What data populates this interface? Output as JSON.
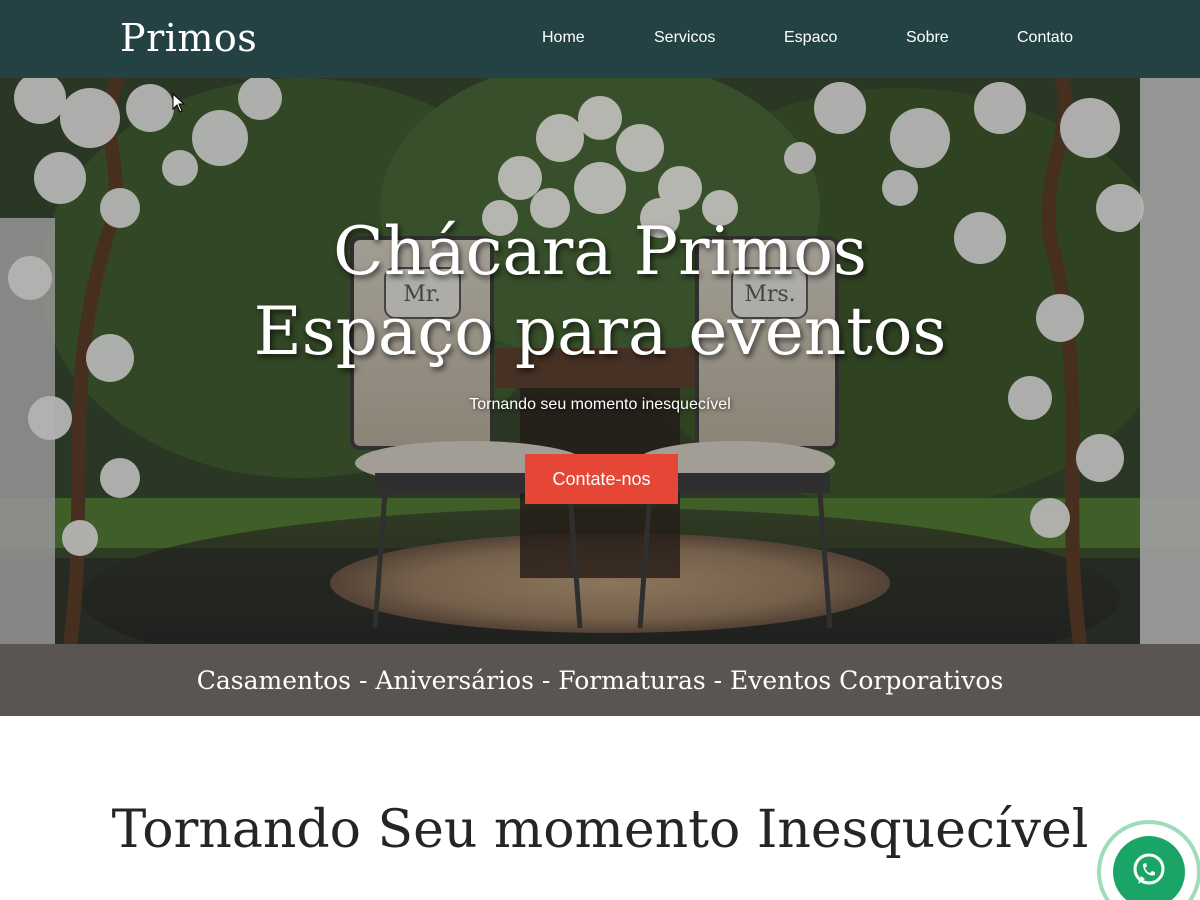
{
  "header": {
    "logo": "Primos",
    "nav": {
      "home": "Home",
      "servicos": "Servicos",
      "espaco": "Espaco",
      "sobre": "Sobre",
      "contato": "Contato"
    }
  },
  "hero": {
    "title_line1": "Chácara Primos",
    "title_line2": "Espaço para eventos",
    "subtitle": "Tornando seu momento inesquecível",
    "cta": "Contate-nos",
    "chair_signs": [
      "Mr.",
      "Mrs."
    ]
  },
  "strip": {
    "text": "Casamentos - Aniversários - Formaturas - Eventos Corporativos"
  },
  "section": {
    "heading": "Tornando Seu momento Inesquecível"
  },
  "whatsapp": {
    "icon": "whatsapp-icon"
  },
  "colors": {
    "header_bg": "#244244",
    "cta_bg": "#e64635",
    "strip_bg": "#5a5552",
    "whatsapp": "#1aa567"
  }
}
